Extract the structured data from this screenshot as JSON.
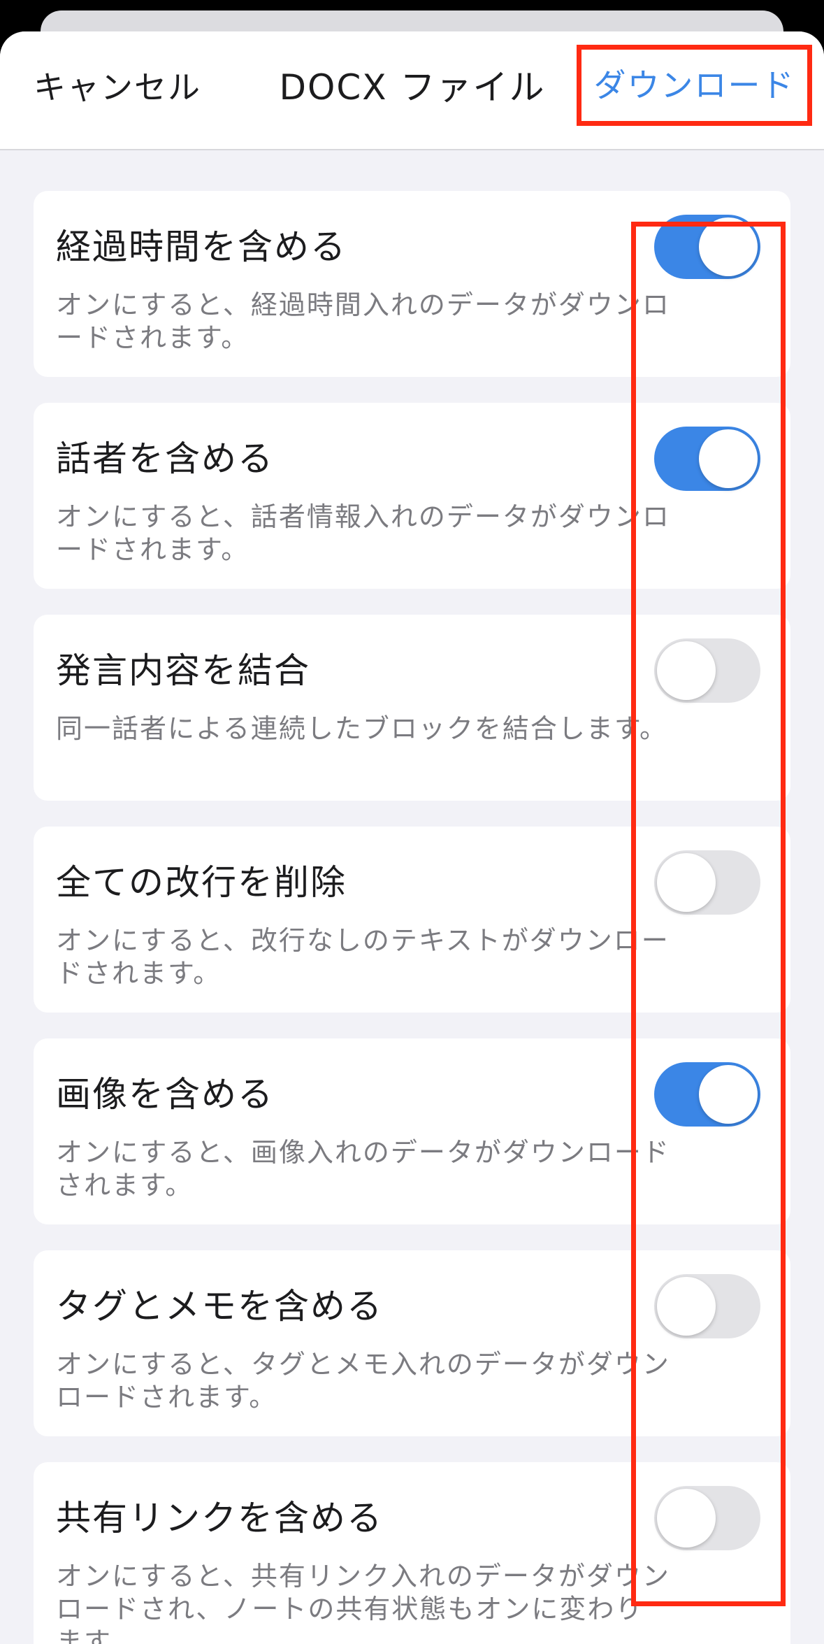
{
  "nav": {
    "cancel_label": "キャンセル",
    "title": "DOCX ファイル",
    "download_label": "ダウンロード"
  },
  "options": [
    {
      "label": "経過時間を含める",
      "description": "オンにすると、経過時間入れのデータがダウンロードされます。",
      "enabled": true
    },
    {
      "label": "話者を含める",
      "description": "オンにすると、話者情報入れのデータがダウンロードされます。",
      "enabled": true
    },
    {
      "label": "発言内容を結合",
      "description": "同一話者による連続したブロックを結合します。",
      "enabled": false
    },
    {
      "label": "全ての改行を削除",
      "description": "オンにすると、改行なしのテキストがダウンロードされます。",
      "enabled": false
    },
    {
      "label": "画像を含める",
      "description": "オンにすると、画像入れのデータがダウンロードされます。",
      "enabled": true
    },
    {
      "label": "タグとメモを含める",
      "description": "オンにすると、タグとメモ入れのデータがダウンロードされます。",
      "enabled": false
    },
    {
      "label": "共有リンクを含める",
      "description": "オンにすると、共有リンク入れのデータがダウンロードされ、ノートの共有状態もオンに変わります。",
      "enabled": false
    }
  ],
  "colors": {
    "accent": "#3b86e6",
    "highlight": "#ff2a12",
    "toggle_off": "#e3e3e6",
    "background": "#f2f2f7"
  }
}
